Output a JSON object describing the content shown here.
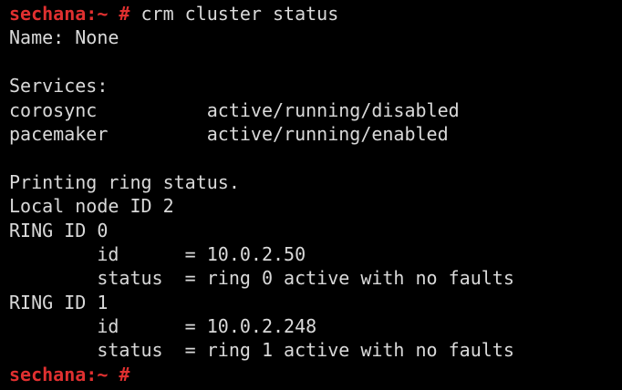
{
  "colors": {
    "background": "#000000",
    "text": "#d9d9d9",
    "prompt": "#e03030"
  },
  "terminal": {
    "prompt": "sechana:~ #",
    "command": "crm cluster status",
    "output": [
      "Name: None",
      "",
      "Services:",
      "corosync          active/running/disabled",
      "pacemaker         active/running/enabled",
      "",
      "Printing ring status.",
      "Local node ID 2",
      "RING ID 0",
      "        id      = 10.0.2.50",
      "        status  = ring 0 active with no faults",
      "RING ID 1",
      "        id      = 10.0.2.248",
      "        status  = ring 1 active with no faults"
    ],
    "final_prompt": "sechana:~ #"
  }
}
